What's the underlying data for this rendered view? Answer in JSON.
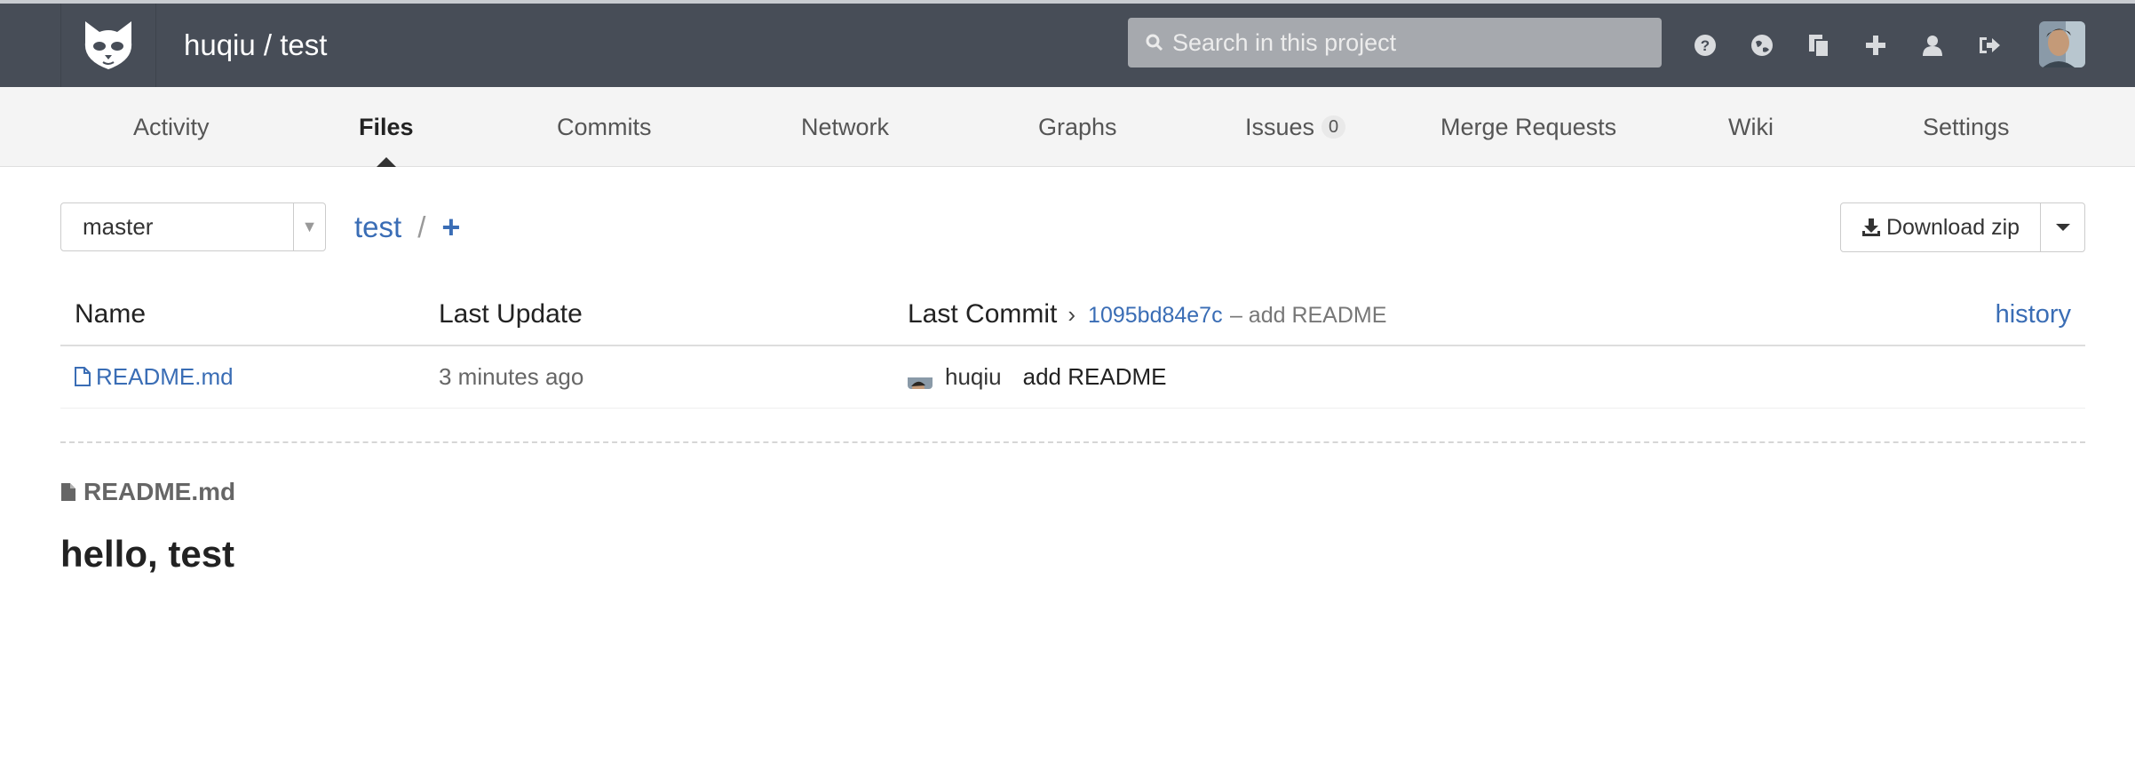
{
  "header": {
    "project_title": "huqiu / test",
    "search_placeholder": "Search in this project",
    "icons": [
      "help-icon",
      "explore-icon",
      "snippets-icon",
      "new-project-icon",
      "profile-icon",
      "sign-out-icon"
    ]
  },
  "subnav": {
    "tabs": [
      {
        "label": "Activity"
      },
      {
        "label": "Files",
        "active": true
      },
      {
        "label": "Commits"
      },
      {
        "label": "Network"
      },
      {
        "label": "Graphs"
      },
      {
        "label": "Issues",
        "count": "0"
      },
      {
        "label": "Merge Requests"
      },
      {
        "label": "Wiki"
      },
      {
        "label": "Settings"
      }
    ]
  },
  "tree": {
    "branch": "master",
    "breadcrumb": "test",
    "breadcrumb_sep": "/",
    "add_symbol": "+",
    "download_label": "Download zip"
  },
  "table": {
    "headers": {
      "name": "Name",
      "last_update": "Last Update",
      "last_commit": "Last Commit",
      "commit_sha": "1095bd84e7c",
      "commit_message": "– add README",
      "history": "history"
    },
    "rows": [
      {
        "name": "README.md",
        "last_update": "3 minutes ago",
        "author": "huqiu",
        "message": "add README"
      }
    ]
  },
  "readme": {
    "filename": "README.md",
    "heading": "hello, test"
  },
  "colors": {
    "header_bg": "#474d57",
    "link": "#3a6db5",
    "subnav_bg": "#f4f4f4"
  }
}
